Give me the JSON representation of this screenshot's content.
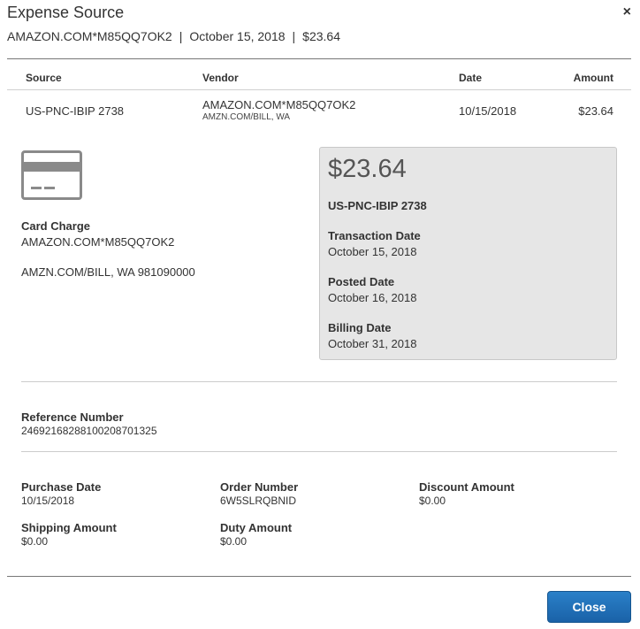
{
  "dialog": {
    "title": "Expense Source",
    "close_icon": "×",
    "subtitle": {
      "vendor": "AMAZON.COM*M85QQ7OK2",
      "separator": "|",
      "date": "October 15, 2018",
      "amount": "$23.64"
    }
  },
  "table": {
    "headers": {
      "source": "Source",
      "vendor": "Vendor",
      "date": "Date",
      "amount": "Amount"
    },
    "row": {
      "source": "US-PNC-IBIP 2738",
      "vendor": "AMAZON.COM*M85QQ7OK2",
      "vendor_location": "AMZN.COM/BILL, WA",
      "date": "10/15/2018",
      "amount": "$23.64"
    }
  },
  "charge": {
    "icon": "credit-card-icon",
    "type": "Card Charge",
    "vendor": "AMAZON.COM*M85QQ7OK2",
    "address": "AMZN.COM/BILL, WA 981090000"
  },
  "summary": {
    "amount": "$23.64",
    "account": "US-PNC-IBIP 2738",
    "transaction_date_label": "Transaction Date",
    "transaction_date": "October 15, 2018",
    "posted_date_label": "Posted Date",
    "posted_date": "October 16, 2018",
    "billing_date_label": "Billing Date",
    "billing_date": "October 31, 2018"
  },
  "reference": {
    "label": "Reference Number",
    "value": "24692168288100208701325"
  },
  "details": {
    "purchase_date_label": "Purchase Date",
    "purchase_date": "10/15/2018",
    "order_number_label": "Order Number",
    "order_number": "6W5SLRQBNID",
    "discount_amount_label": "Discount Amount",
    "discount_amount": "$0.00",
    "shipping_amount_label": "Shipping Amount",
    "shipping_amount": "$0.00",
    "duty_amount_label": "Duty Amount",
    "duty_amount": "$0.00"
  },
  "footer": {
    "close_label": "Close"
  },
  "colors": {
    "primary_button": "#1e73be",
    "summary_panel": "#e6e6e6",
    "icon_gray": "#8a8a8a"
  }
}
